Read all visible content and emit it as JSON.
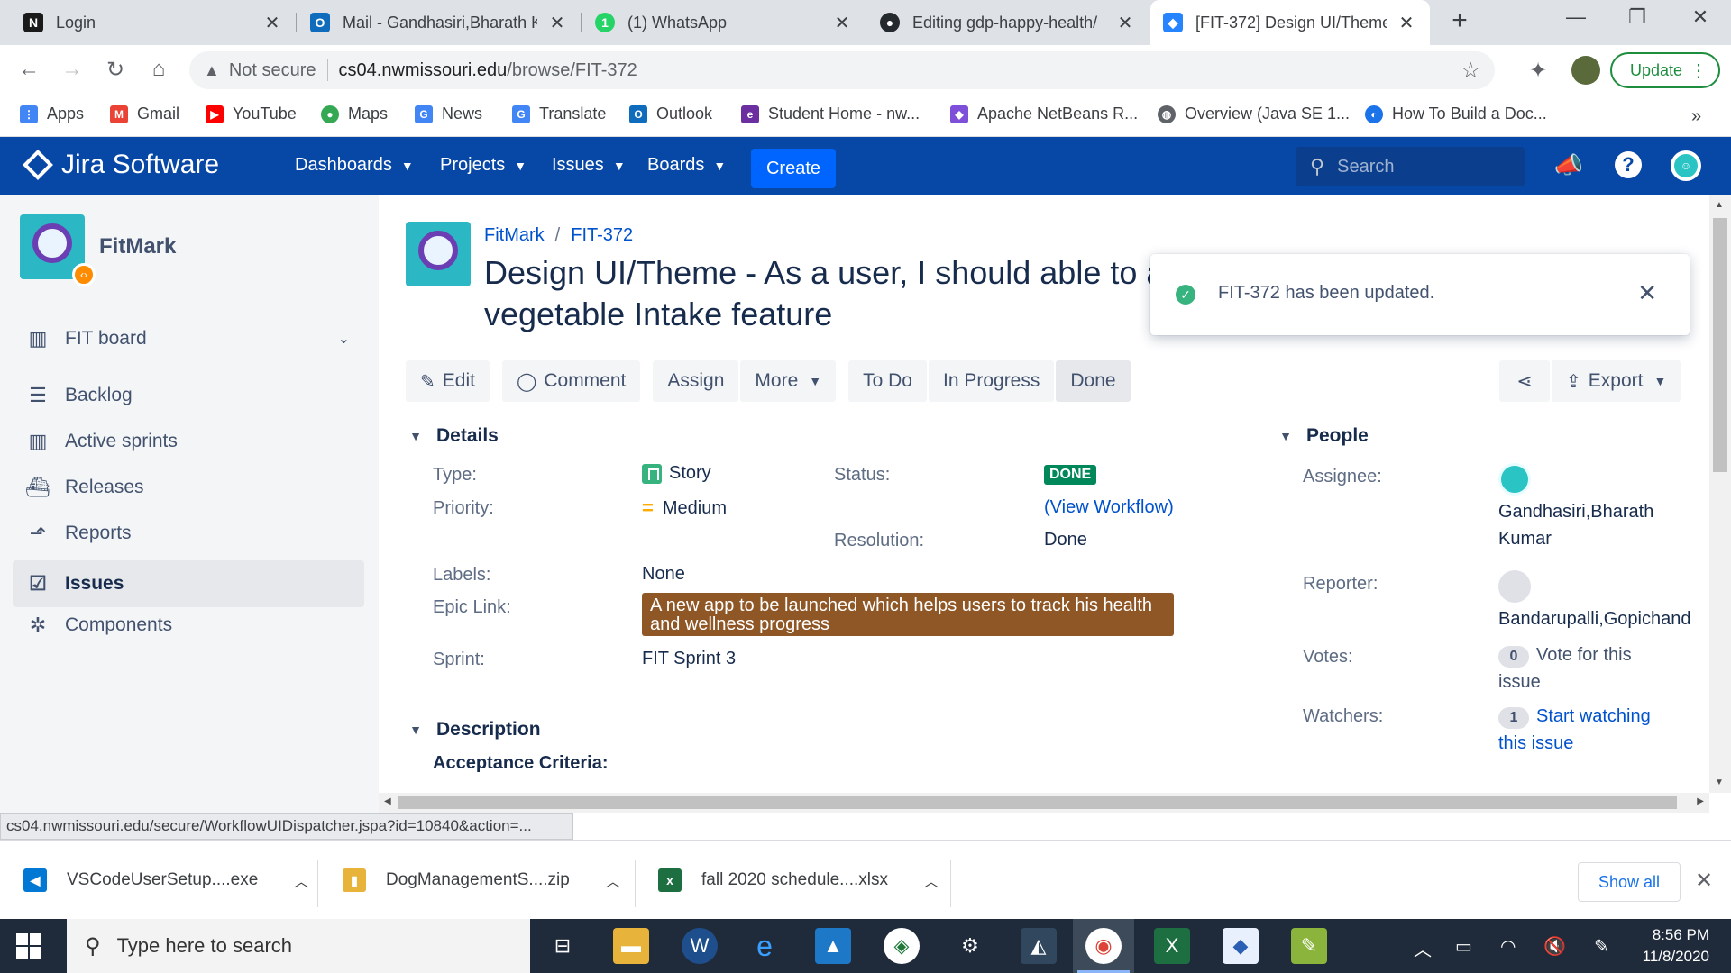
{
  "browser": {
    "tabs": [
      {
        "title": "Login",
        "icon": "notion-icon",
        "color": "#1a1a1a",
        "glyph": "N"
      },
      {
        "title": "Mail - Gandhasiri,Bharath K",
        "icon": "outlook-icon",
        "color": "#0f6cbd",
        "glyph": "O"
      },
      {
        "title": "(1) WhatsApp",
        "icon": "whatsapp-icon",
        "color": "#25d366",
        "glyph": "1"
      },
      {
        "title": "Editing gdp-happy-health/",
        "icon": "github-icon",
        "color": "#24292e",
        "glyph": "●"
      },
      {
        "title": "[FIT-372] Design UI/Theme",
        "icon": "jira-icon",
        "color": "#2684ff",
        "glyph": "◆"
      }
    ],
    "url_warning": "Not secure",
    "url_host": "cs04.nwmissouri.edu",
    "url_path": "/browse/FIT-372",
    "update_label": "Update",
    "bookmarks": [
      {
        "label": "Apps",
        "icon": "apps-grid-icon",
        "color": "#ea4335",
        "glyph": "⋮"
      },
      {
        "label": "Gmail",
        "icon": "gmail-icon",
        "color": "#ea4335",
        "glyph": "M"
      },
      {
        "label": "YouTube",
        "icon": "youtube-icon",
        "color": "#ff0000",
        "glyph": "▶"
      },
      {
        "label": "Maps",
        "icon": "maps-icon",
        "color": "#34a853",
        "glyph": "●"
      },
      {
        "label": "News",
        "icon": "news-icon",
        "color": "#4285f4",
        "glyph": "G"
      },
      {
        "label": "Translate",
        "icon": "translate-icon",
        "color": "#4285f4",
        "glyph": "G"
      },
      {
        "label": "Outlook",
        "icon": "outlook-icon",
        "color": "#0f6cbd",
        "glyph": "O"
      },
      {
        "label": "Student Home - nw...",
        "icon": "student-home-icon",
        "color": "#6b2fa0",
        "glyph": "e"
      },
      {
        "label": "Apache NetBeans R...",
        "icon": "netbeans-icon",
        "color": "#7e4fd8",
        "glyph": "◆"
      },
      {
        "label": "Overview (Java SE 1...",
        "icon": "java-globe-icon",
        "color": "#5f6368",
        "glyph": "◍"
      },
      {
        "label": "How To Build a Doc...",
        "icon": "doc-builder-icon",
        "color": "#1a73e8",
        "glyph": "◐"
      }
    ]
  },
  "jira": {
    "brand": "Jira Software",
    "menus": [
      "Dashboards",
      "Projects",
      "Issues",
      "Boards"
    ],
    "create_label": "Create",
    "search_placeholder": "Search"
  },
  "sidebar": {
    "project_name": "FitMark",
    "items": [
      {
        "label": "FIT board",
        "icon": "board-icon",
        "glyph": "▥"
      },
      {
        "label": "Backlog",
        "icon": "backlog-icon",
        "glyph": "☰"
      },
      {
        "label": "Active sprints",
        "icon": "active-sprints-icon",
        "glyph": "▥"
      },
      {
        "label": "Releases",
        "icon": "releases-icon",
        "glyph": "⛴"
      },
      {
        "label": "Reports",
        "icon": "reports-icon",
        "glyph": "⬏"
      },
      {
        "label": "Issues",
        "icon": "issues-icon",
        "glyph": "☑"
      },
      {
        "label": "Components",
        "icon": "components-icon",
        "glyph": "✲"
      }
    ],
    "active_item": "Issues"
  },
  "issue": {
    "project_link": "FitMark",
    "key": "FIT-372",
    "title": "Design UI/Theme - As a user, I should able to a vegetable Intake feature",
    "actions": {
      "edit": "Edit",
      "comment": "Comment",
      "assign": "Assign",
      "more": "More",
      "todo": "To Do",
      "in_progress": "In Progress",
      "done": "Done",
      "export": "Export"
    },
    "details_header": "Details",
    "details": {
      "type_label": "Type:",
      "type_value": "Story",
      "priority_label": "Priority:",
      "priority_value": "Medium",
      "status_label": "Status:",
      "status_value": "DONE",
      "view_workflow": "(View Workflow)",
      "resolution_label": "Resolution:",
      "resolution_value": "Done",
      "labels_label": "Labels:",
      "labels_value": "None",
      "epic_label": "Epic Link:",
      "epic_value": "A new app to be launched which helps users to track his health and wellness progress",
      "epic_color": "#8f5626",
      "sprint_label": "Sprint:",
      "sprint_value": "FIT Sprint 3"
    },
    "people_header": "People",
    "people": {
      "assignee_label": "Assignee:",
      "assignee_value": "Gandhasiri,Bharath Kumar",
      "reporter_label": "Reporter:",
      "reporter_value": "Bandarupalli,Gopichand",
      "votes_label": "Votes:",
      "votes_count": "0",
      "votes_link": "Vote for this issue",
      "watchers_label": "Watchers:",
      "watchers_count": "1",
      "watchers_link": "Start watching this issue"
    },
    "description_header": "Description",
    "acceptance": "Acceptance Criteria:",
    "status_color": "#00875a"
  },
  "toast": {
    "message": "FIT-372 has been updated."
  },
  "status_url": "cs04.nwmissouri.edu/secure/WorkflowUIDispatcher.jspa?id=10840&action=...",
  "downloads": {
    "items": [
      {
        "name": "VSCodeUserSetup....exe",
        "icon": "vscode-icon",
        "color": "#0078d4",
        "glyph": "◀"
      },
      {
        "name": "DogManagementS....zip",
        "icon": "zip-folder-icon",
        "color": "#e8b33a",
        "glyph": "▮"
      },
      {
        "name": "fall 2020 schedule....xlsx",
        "icon": "excel-icon",
        "color": "#1d6f42",
        "glyph": "x"
      }
    ],
    "show_all": "Show all"
  },
  "taskbar": {
    "search_placeholder": "Type here to search",
    "time": "8:56 PM",
    "date": "11/8/2020"
  }
}
